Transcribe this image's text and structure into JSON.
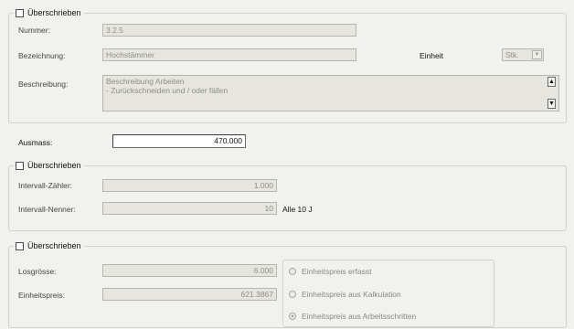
{
  "section_main": {
    "override_label": "Überschrieben",
    "override_checked": false,
    "nummer": {
      "label": "Nummer:",
      "value": "3.2.5"
    },
    "bezeichnung": {
      "label": "Bezeichnung:",
      "value": "Hochstämmer"
    },
    "einheit": {
      "label": "Einheit",
      "value": "Stk."
    },
    "beschreibung": {
      "label": "Beschreibung:",
      "line1": "Beschreibung Arbeiten",
      "line2": "- Zurückschneiden und / oder fällen"
    }
  },
  "ausmass": {
    "label": "Ausmass:",
    "value": "470.000"
  },
  "section_interval": {
    "override_label": "Überschrieben",
    "override_checked": false,
    "zaehler": {
      "label": "Intervall-Zähler:",
      "value": "1.000"
    },
    "nenner": {
      "label": "Intervall-Nenner:",
      "value": "10",
      "suffix": "Alle 10 J"
    }
  },
  "section_price": {
    "override_label": "Überschrieben",
    "override_checked": false,
    "losgroesse": {
      "label": "Losgrösse:",
      "value": "6.000"
    },
    "einheitspreis": {
      "label": "Einheitspreis:",
      "value": "621.3867"
    },
    "radio_options": [
      {
        "label": "Einheitspreis erfasst",
        "selected": false
      },
      {
        "label": "Einheitspreis aus Kalkulation",
        "selected": false
      },
      {
        "label": "Einheitspreis aus Arbeitsschritten",
        "selected": true
      }
    ]
  }
}
